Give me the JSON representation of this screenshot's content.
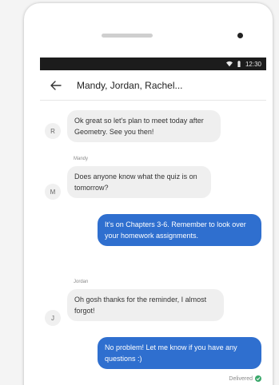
{
  "status_bar": {
    "time": "12:30",
    "icons": [
      "wifi-icon",
      "battery-icon"
    ]
  },
  "header": {
    "title": "Mandy, Jordan, Rachel...",
    "back_icon": "arrow-left-icon"
  },
  "messages": [
    {
      "direction": "incoming",
      "avatar": "R",
      "sender": "",
      "text": "Ok great so let's plan to meet today after Geometry. See you then!"
    },
    {
      "direction": "incoming",
      "avatar": "M",
      "sender": "Mandy",
      "text": "Does anyone know what the quiz is on tomorrow?"
    },
    {
      "direction": "outgoing",
      "text": "It's on Chapters 3-6. Remember to look over your homework assignments."
    },
    {
      "direction": "incoming",
      "avatar": "J",
      "sender": "Jordan",
      "text": "Oh gosh thanks for the reminder, I almost forgot!"
    },
    {
      "direction": "outgoing",
      "text": "No problem! Let me know if you have any questions :)"
    }
  ],
  "delivery_status": "Delivered",
  "colors": {
    "outgoing_bubble": "#2f6fcf",
    "incoming_bubble": "#efefef",
    "status_bar": "#1c1c1c",
    "delivered_check": "#3aa86b"
  }
}
